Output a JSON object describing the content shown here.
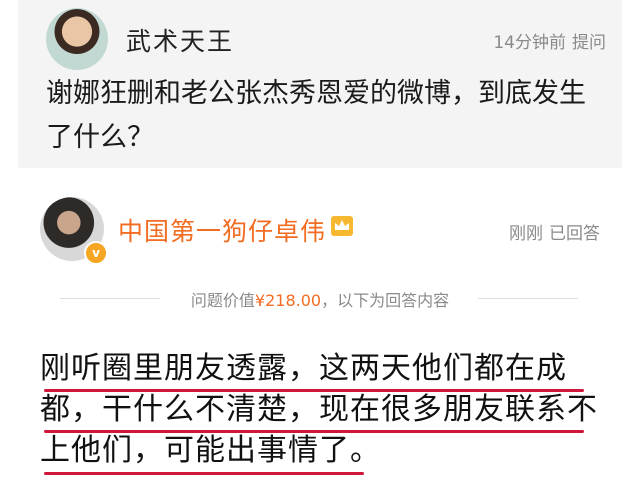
{
  "question": {
    "user_name": "武术天王",
    "time": "14分钟前",
    "label": "提问",
    "text": "谢娜狂删和老公张杰秀恩爱的微博，到底发生了什么？"
  },
  "answer": {
    "user_name": "中国第一狗仔卓伟",
    "time": "刚刚",
    "status": "已回答",
    "price_prefix": "问题价值",
    "price": "¥218.00",
    "price_suffix": "，以下为回答内容",
    "lines": [
      "刚听圈里朋友透露，这两天他们都在成",
      "都，干什么不清楚，现在很多朋友联系不",
      "上他们，可能出事情了。"
    ]
  },
  "colors": {
    "accent": "#f26c22",
    "underline": "#d0163a"
  },
  "icons": {
    "crown": "crown-icon",
    "verified": "verified-badge-icon"
  }
}
